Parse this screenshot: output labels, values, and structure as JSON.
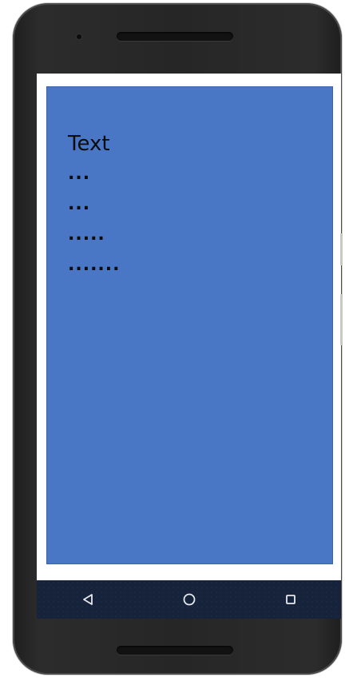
{
  "device": {
    "frame_color": "#262626",
    "screen_bg": "#ffffff"
  },
  "app": {
    "panel_color": "#4a76c6",
    "heading": "Text",
    "items": [
      "...",
      "...",
      ".....",
      "......."
    ]
  },
  "navigation": {
    "bar_color": "#16233a",
    "buttons": [
      {
        "name": "back",
        "icon": "back-triangle-icon"
      },
      {
        "name": "home",
        "icon": "home-circle-icon"
      },
      {
        "name": "recents",
        "icon": "recents-square-icon"
      }
    ]
  }
}
